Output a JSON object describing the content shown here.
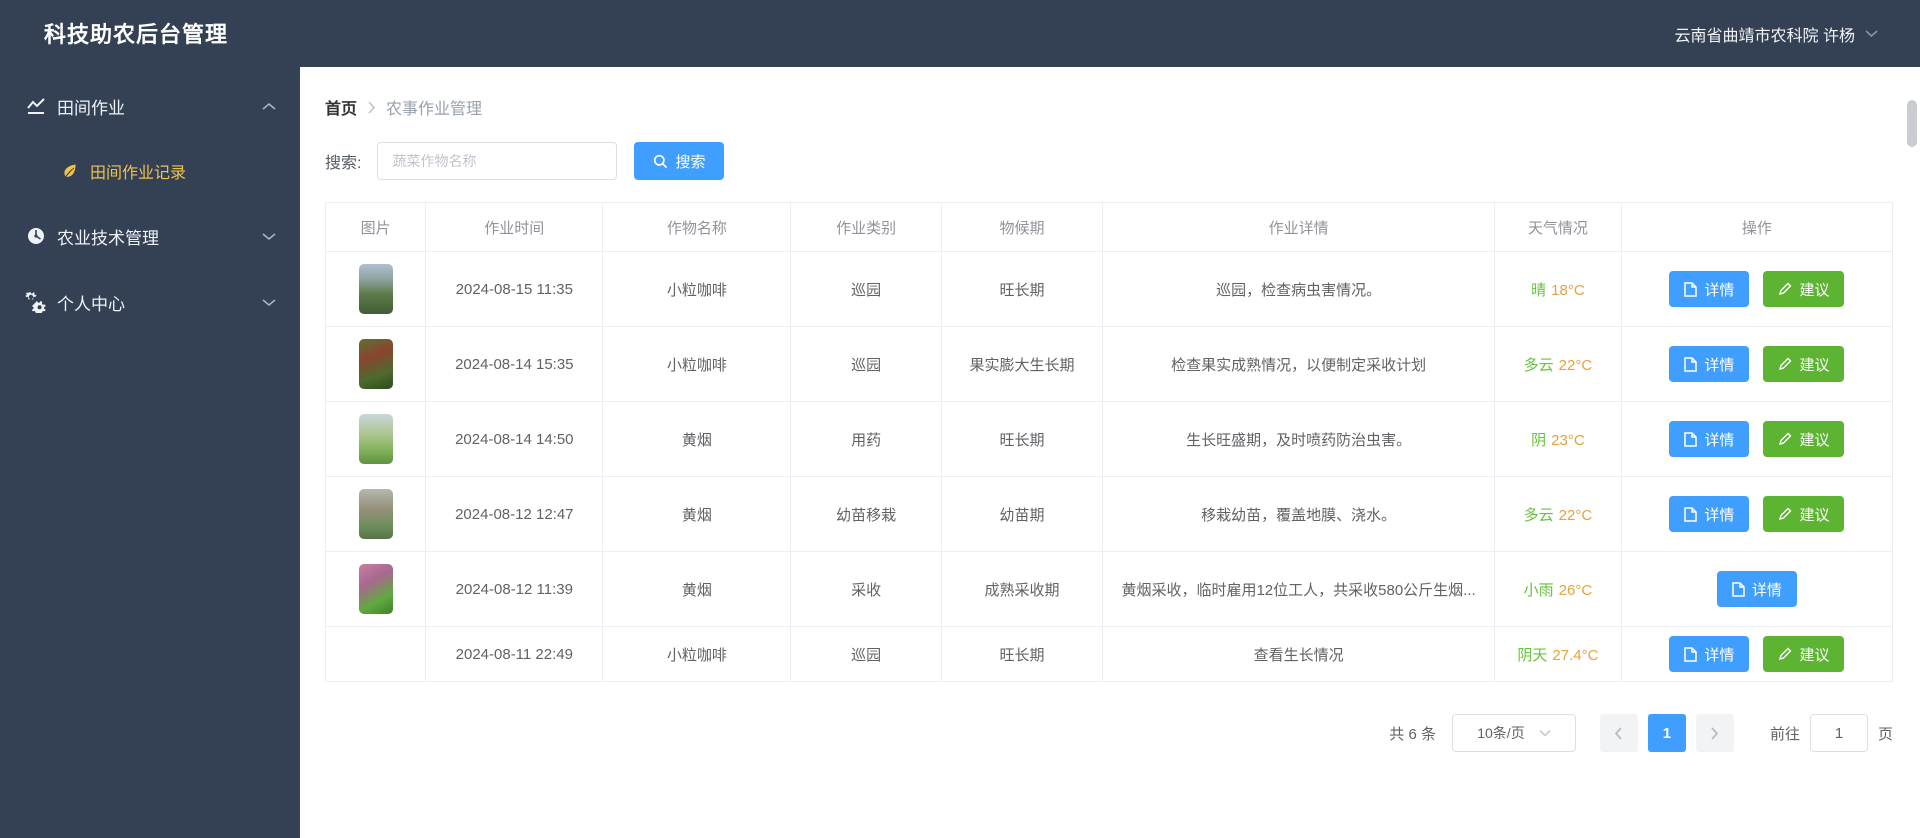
{
  "app": {
    "title": "科技助农后台管理"
  },
  "header": {
    "user": "云南省曲靖市农科院 许杨"
  },
  "sidebar": {
    "items": [
      {
        "label": "田间作业",
        "icon": "line-chart-icon",
        "expanded": true
      },
      {
        "label": "田间作业记录",
        "icon": "leaf-icon",
        "active": true
      },
      {
        "label": "农业技术管理",
        "icon": "dashboard-icon",
        "expanded": false
      },
      {
        "label": "个人中心",
        "icon": "gears-icon",
        "expanded": false
      }
    ]
  },
  "breadcrumb": {
    "home": "首页",
    "current": "农事作业管理"
  },
  "search": {
    "label": "搜索:",
    "placeholder": "蔬菜作物名称",
    "button": "搜索"
  },
  "table": {
    "headers": [
      "图片",
      "作业时间",
      "作物名称",
      "作业类别",
      "物候期",
      "作业详情",
      "天气情况",
      "操作"
    ],
    "rows": [
      {
        "time": "2024-08-15 11:35",
        "crop": "小粒咖啡",
        "category": "巡园",
        "phenophase": "旺长期",
        "detail": "巡园，检查病虫害情况。",
        "weather": "晴",
        "temp": "18°C"
      },
      {
        "time": "2024-08-14 15:35",
        "crop": "小粒咖啡",
        "category": "巡园",
        "phenophase": "果实膨大生长期",
        "detail": "检查果实成熟情况，以便制定采收计划",
        "weather": "多云",
        "temp": "22°C"
      },
      {
        "time": "2024-08-14 14:50",
        "crop": "黄烟",
        "category": "用药",
        "phenophase": "旺长期",
        "detail": "生长旺盛期，及时喷药防治虫害。",
        "weather": "阴",
        "temp": "23°C"
      },
      {
        "time": "2024-08-12 12:47",
        "crop": "黄烟",
        "category": "幼苗移栽",
        "phenophase": "幼苗期",
        "detail": "移栽幼苗，覆盖地膜、浇水。",
        "weather": "多云",
        "temp": "22°C"
      },
      {
        "time": "2024-08-12 11:39",
        "crop": "黄烟",
        "category": "采收",
        "phenophase": "成熟采收期",
        "detail": "黄烟采收，临时雇用12位工人，共采收580公斤生烟...",
        "weather": "小雨",
        "temp": "26°C"
      },
      {
        "time": "2024-08-11 22:49",
        "crop": "小粒咖啡",
        "category": "巡园",
        "phenophase": "旺长期",
        "detail": "查看生长情况",
        "weather": "阴天",
        "temp": "27.4°C"
      }
    ]
  },
  "actions": {
    "detail": "详情",
    "advice": "建议"
  },
  "pagination": {
    "total": "共 6 条",
    "page_size": "10条/页",
    "page": "1",
    "goto": "前往",
    "page_unit": "页"
  },
  "colors": {
    "accent_blue": "#409eff",
    "success_green": "#67c23a",
    "warning_orange": "#e6a23c",
    "sidebar_bg": "#344154",
    "active_menu_gold": "#f0c249"
  }
}
